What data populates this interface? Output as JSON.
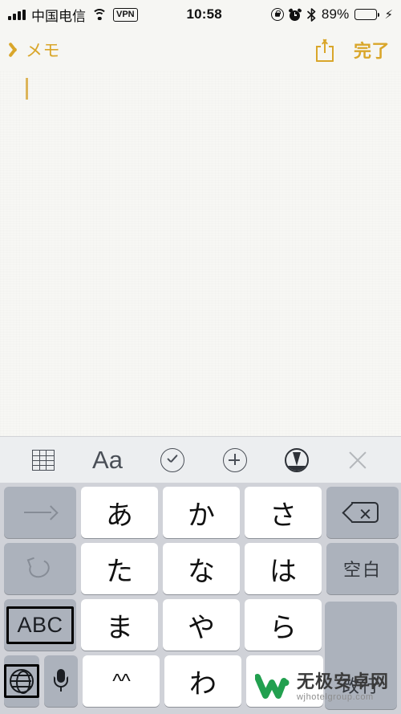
{
  "statusbar": {
    "carrier": "中国电信",
    "vpn": "VPN",
    "time": "10:58",
    "battery_percent": "89%",
    "signal_icon": "signal-bars-icon",
    "wifi_icon": "wifi-icon",
    "rotation_lock_icon": "rotation-lock-icon",
    "alarm_icon": "alarm-clock-icon",
    "bluetooth_icon": "bluetooth-icon",
    "battery_icon": "battery-icon",
    "charging_icon": "charging-bolt-icon",
    "battery_fill_color": "#34c85a"
  },
  "navbar": {
    "back_label": "メモ",
    "back_icon": "chevron-left-icon",
    "share_icon": "share-icon",
    "done_label": "完了",
    "accent_color": "#d9a62a"
  },
  "note": {
    "body_text": "",
    "caret_color": "#dcb55a",
    "paper_color": "#f7f7f4"
  },
  "toolbar": {
    "items": [
      {
        "name": "table-icon",
        "label": ""
      },
      {
        "name": "text-format-icon",
        "label": "Aa"
      },
      {
        "name": "checklist-icon",
        "label": ""
      },
      {
        "name": "add-attachment-icon",
        "label": ""
      },
      {
        "name": "markup-pen-icon",
        "label": ""
      },
      {
        "name": "close-icon",
        "label": ""
      }
    ],
    "background": "#eceef0"
  },
  "keyboard": {
    "background": "#d0d2d8",
    "rows": [
      {
        "left": {
          "name": "next-candidate-key",
          "label": "",
          "icon": "arrow-right-icon",
          "style": "gray",
          "dimmed": true
        },
        "keys": [
          {
            "name": "key-a",
            "label": "あ"
          },
          {
            "name": "key-ka",
            "label": "か"
          },
          {
            "name": "key-sa",
            "label": "さ"
          }
        ],
        "right": {
          "name": "delete-key",
          "label": "",
          "icon": "delete-backspace-icon",
          "style": "gray"
        }
      },
      {
        "left": {
          "name": "undo-key",
          "label": "",
          "icon": "undo-arrow-icon",
          "style": "gray",
          "dimmed": true
        },
        "keys": [
          {
            "name": "key-ta",
            "label": "た"
          },
          {
            "name": "key-na",
            "label": "な"
          },
          {
            "name": "key-ha",
            "label": "は"
          }
        ],
        "right": {
          "name": "space-key",
          "label": "空白",
          "icon": "",
          "style": "gray"
        }
      },
      {
        "left": {
          "name": "abc-keyboard-key",
          "label": "ABC",
          "icon": "",
          "style": "gray",
          "focused": true
        },
        "keys": [
          {
            "name": "key-ma",
            "label": "ま"
          },
          {
            "name": "key-ya",
            "label": "や"
          },
          {
            "name": "key-ra",
            "label": "ら"
          }
        ],
        "right": null
      },
      {
        "left": {
          "name": "globe-language-key",
          "label": "",
          "icon": "globe-icon",
          "style": "gray",
          "focused": true
        },
        "left2": {
          "name": "dictation-key",
          "label": "",
          "icon": "microphone-icon",
          "style": "gray"
        },
        "keys": [
          {
            "name": "key-kaomoji",
            "label": "^^"
          },
          {
            "name": "key-wa",
            "label": "わ"
          },
          {
            "name": "key-punctuation",
            "label": ""
          }
        ],
        "right": null
      }
    ],
    "return_key": {
      "name": "return-key",
      "label": "改行"
    }
  },
  "watermark": {
    "site_name": "无极安卓网",
    "url": "wjhotelgroup.com",
    "logo_color": "#22a04f"
  }
}
